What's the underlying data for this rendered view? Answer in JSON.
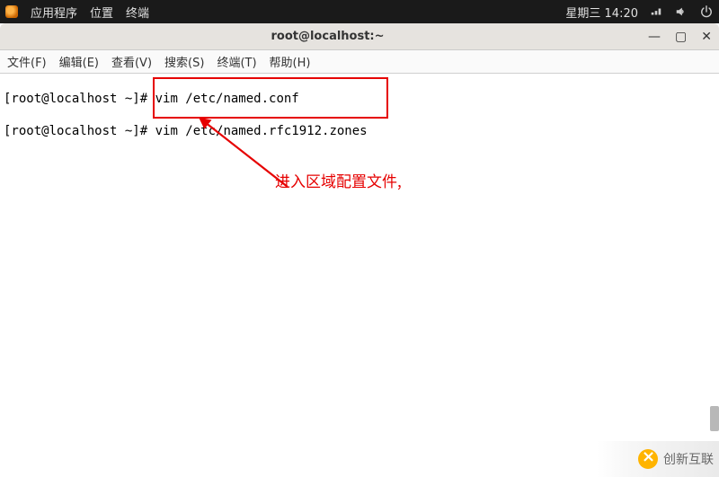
{
  "system_panel": {
    "apps_label": "应用程序",
    "places_label": "位置",
    "terminal_label": "终端",
    "clock": "星期三 14:20"
  },
  "window": {
    "title": "root@localhost:~"
  },
  "menubar": {
    "file": "文件(F)",
    "edit": "编辑(E)",
    "view": "查看(V)",
    "search": "搜索(S)",
    "terminal": "终端(T)",
    "help": "帮助(H)"
  },
  "terminal_lines": {
    "prompt1": "[root@localhost ~]#",
    "cmd1": "vim /etc/named.conf",
    "prompt2": "[root@localhost ~]#",
    "cmd2": "vim /etc/named.rfc1912.zones"
  },
  "annotation": {
    "text": "进入区域配置文件,"
  },
  "watermark": {
    "text": "创新互联"
  },
  "colors": {
    "highlight": "#e60000",
    "panel_bg": "#1a1a1a"
  }
}
